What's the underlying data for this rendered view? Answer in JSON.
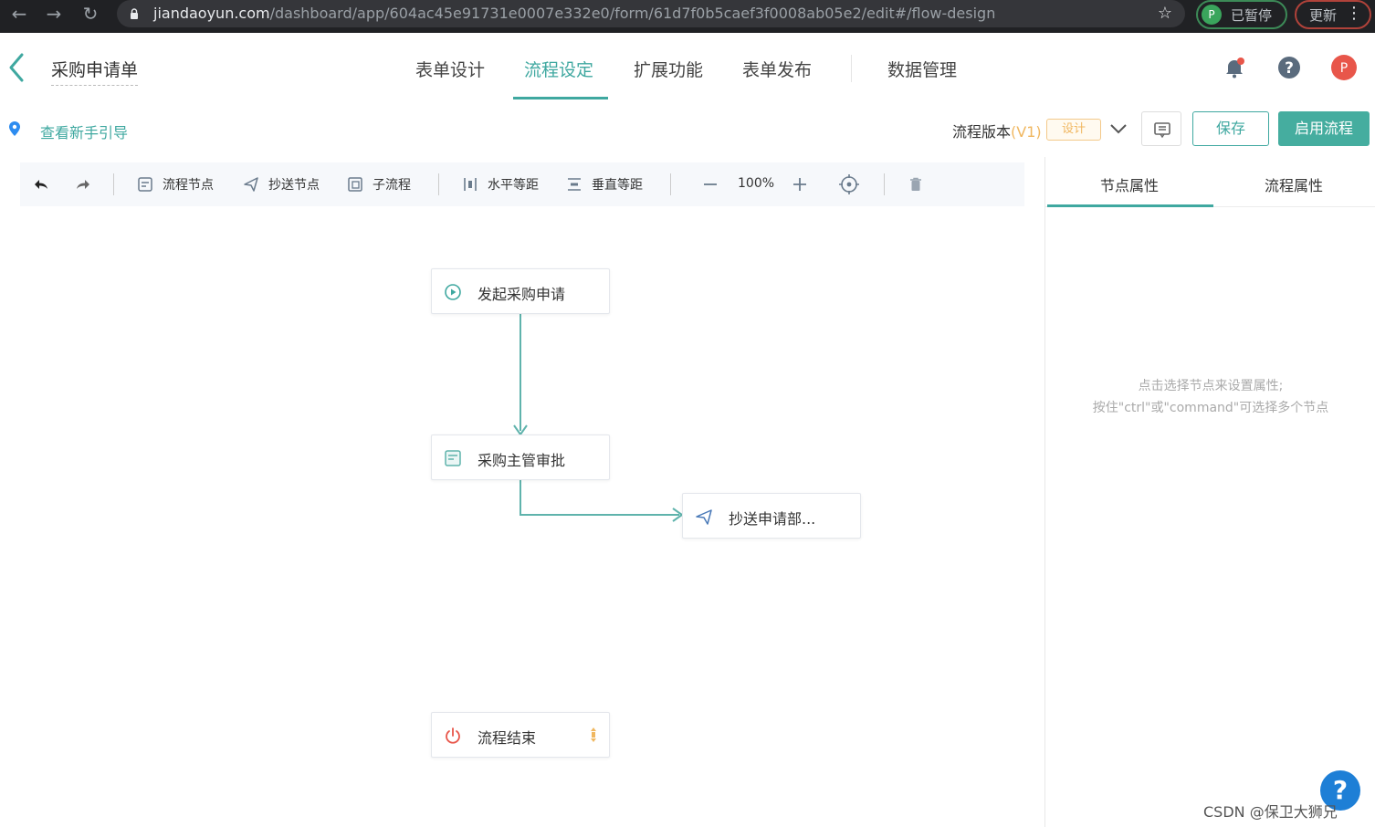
{
  "browser": {
    "url_host": "jiandaoyun.com",
    "url_path": "/dashboard/app/604ac45e91731e0007e332e0/form/61d7f0b5caef3f0008ab05e2/edit#/flow-design",
    "profile_initial": "P",
    "profile_status": "已暂停",
    "update_label": "更新"
  },
  "header": {
    "form_title": "采购申请单",
    "tabs": [
      "表单设计",
      "流程设定",
      "扩展功能",
      "表单发布",
      "数据管理"
    ],
    "active_tab": "流程设定",
    "avatar_initial": "P"
  },
  "subbar": {
    "guide_link": "查看新手引导",
    "version_label": "流程版本",
    "version_tag": "(V1)",
    "design_badge": "设计",
    "save_label": "保存",
    "enable_label": "启用流程"
  },
  "toolbar": {
    "flow_node": "流程节点",
    "cc_node": "抄送节点",
    "sub_flow": "子流程",
    "h_spacing": "水平等距",
    "v_spacing": "垂直等距",
    "zoom": "100%"
  },
  "canvas": {
    "nodes": [
      {
        "label": "发起采购申请",
        "type": "start"
      },
      {
        "label": "采购主管审批",
        "type": "approval"
      },
      {
        "label": "抄送申请部...",
        "type": "cc"
      },
      {
        "label": "流程结束",
        "type": "end"
      }
    ]
  },
  "panel": {
    "tabs": [
      "节点属性",
      "流程属性"
    ],
    "hint_line1": "点击选择节点来设置属性;",
    "hint_line2": "按住\"ctrl\"或\"command\"可选择多个节点"
  },
  "help_label": "?",
  "watermark": "CSDN @保卫大狮兄",
  "colors": {
    "accent": "#3fa8a0",
    "enable_button": "#45ad9f",
    "version_tag": "#f0b760",
    "avatar": "#e8564a",
    "help_fab": "#1e7fd6"
  }
}
